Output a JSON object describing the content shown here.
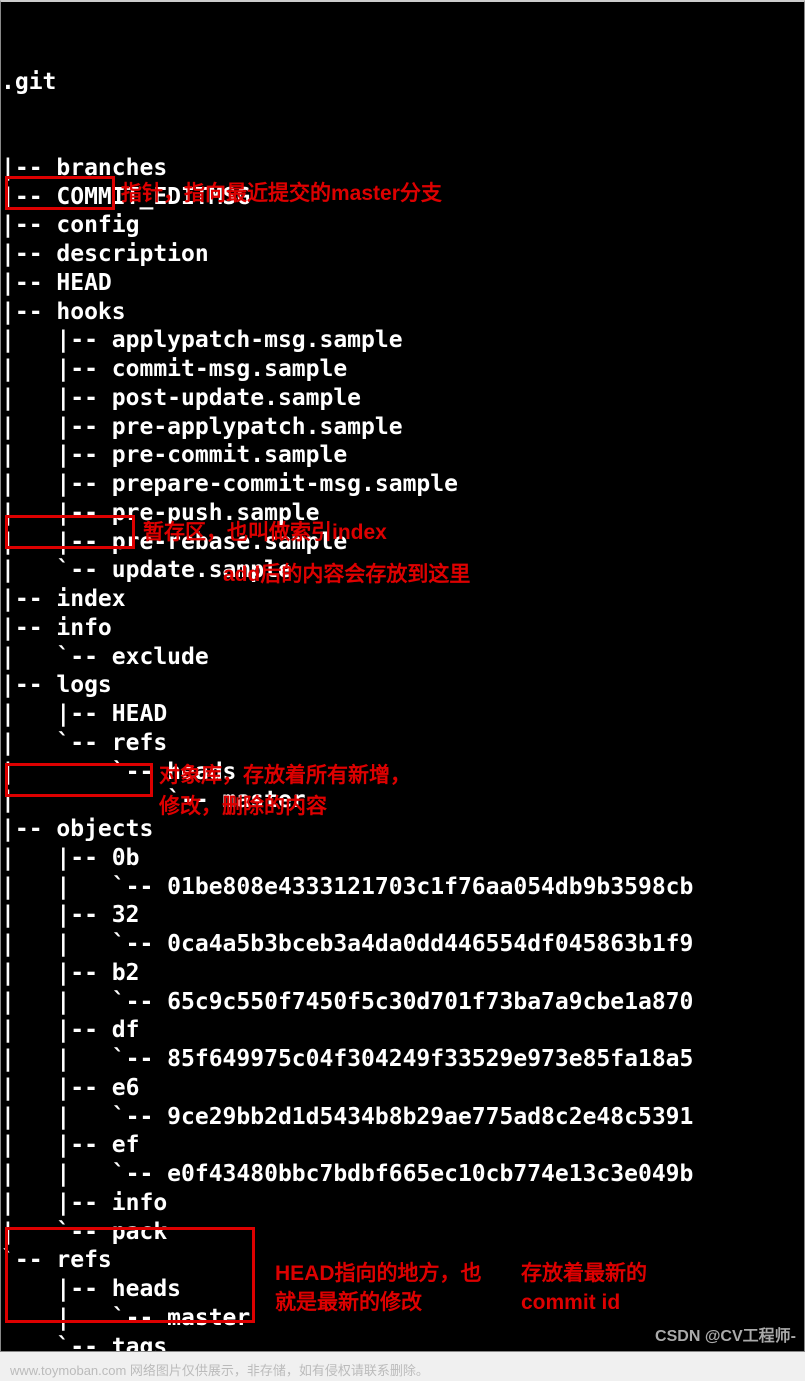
{
  "tree": {
    "root": ".git",
    "items": [
      {
        "prefix": "|-- ",
        "text": "branches"
      },
      {
        "prefix": "|-- ",
        "text": "COMMIT_EDITMSG"
      },
      {
        "prefix": "|-- ",
        "text": "config"
      },
      {
        "prefix": "|-- ",
        "text": "description"
      },
      {
        "prefix": "|-- ",
        "text": "HEAD"
      },
      {
        "prefix": "|-- ",
        "text": "hooks"
      },
      {
        "prefix": "|   |-- ",
        "text": "applypatch-msg.sample"
      },
      {
        "prefix": "|   |-- ",
        "text": "commit-msg.sample"
      },
      {
        "prefix": "|   |-- ",
        "text": "post-update.sample"
      },
      {
        "prefix": "|   |-- ",
        "text": "pre-applypatch.sample"
      },
      {
        "prefix": "|   |-- ",
        "text": "pre-commit.sample"
      },
      {
        "prefix": "|   |-- ",
        "text": "prepare-commit-msg.sample"
      },
      {
        "prefix": "|   |-- ",
        "text": "pre-push.sample"
      },
      {
        "prefix": "|   |-- ",
        "text": "pre-rebase.sample"
      },
      {
        "prefix": "|   `-- ",
        "text": "update.sample"
      },
      {
        "prefix": "|-- ",
        "text": "index"
      },
      {
        "prefix": "|-- ",
        "text": "info"
      },
      {
        "prefix": "|   `-- ",
        "text": "exclude"
      },
      {
        "prefix": "|-- ",
        "text": "logs"
      },
      {
        "prefix": "|   |-- ",
        "text": "HEAD"
      },
      {
        "prefix": "|   `-- ",
        "text": "refs"
      },
      {
        "prefix": "|       `-- ",
        "text": "heads"
      },
      {
        "prefix": "|           `-- ",
        "text": "master"
      },
      {
        "prefix": "|-- ",
        "text": "objects"
      },
      {
        "prefix": "|   |-- ",
        "text": "0b"
      },
      {
        "prefix": "|   |   `-- ",
        "text": "01be808e4333121703c1f76aa054db9b3598cb"
      },
      {
        "prefix": "|   |-- ",
        "text": "32"
      },
      {
        "prefix": "|   |   `-- ",
        "text": "0ca4a5b3bceb3a4da0dd446554df045863b1f9"
      },
      {
        "prefix": "|   |-- ",
        "text": "b2"
      },
      {
        "prefix": "|   |   `-- ",
        "text": "65c9c550f7450f5c30d701f73ba7a9cbe1a870"
      },
      {
        "prefix": "|   |-- ",
        "text": "df"
      },
      {
        "prefix": "|   |   `-- ",
        "text": "85f649975c04f304249f33529e973e85fa18a5"
      },
      {
        "prefix": "|   |-- ",
        "text": "e6"
      },
      {
        "prefix": "|   |   `-- ",
        "text": "9ce29bb2d1d5434b8b29ae775ad8c2e48c5391"
      },
      {
        "prefix": "|   |-- ",
        "text": "ef"
      },
      {
        "prefix": "|   |   `-- ",
        "text": "e0f43480bbc7bdbf665ec10cb774e13c3e049b"
      },
      {
        "prefix": "|   |-- ",
        "text": "info"
      },
      {
        "prefix": "|   `-- ",
        "text": "pack"
      },
      {
        "prefix": "`-- ",
        "text": "refs"
      },
      {
        "prefix": "    |-- ",
        "text": "heads"
      },
      {
        "prefix": "    |   `-- ",
        "text": "master"
      },
      {
        "prefix": "    `-- ",
        "text": "tags"
      }
    ]
  },
  "annotations": {
    "head": "指针，指向最近提交的master分支",
    "index1": "暂存区，也叫做索引index",
    "index2": "add后的内容会存放到这里",
    "objects1": "对象库，存放着所有新增，",
    "objects2": "修改，删除的内容",
    "refs1": "HEAD指向的地方，也就是最新的修改",
    "refs2": "存放着最新的commit id"
  },
  "watermark": "CSDN @CV工程师-",
  "footer": "www.toymoban.com 网络图片仅供展示，非存储，如有侵权请联系删除。"
}
